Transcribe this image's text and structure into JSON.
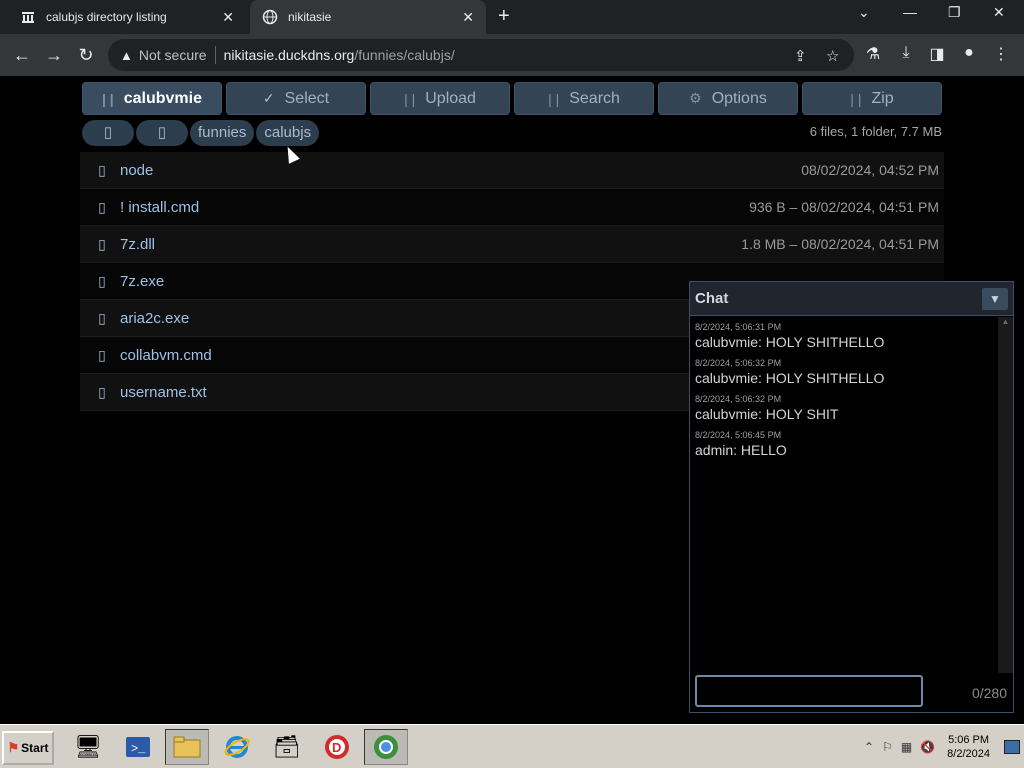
{
  "browser": {
    "tabs": [
      {
        "title": "calubjs directory listing",
        "icon": "bank-icon"
      },
      {
        "title": "nikitasie",
        "icon": "globe-icon"
      }
    ],
    "new_tab": "+",
    "window_controls": {
      "minimize": "—",
      "restore": "❐",
      "close": "✕",
      "dropdown": "⌄"
    },
    "nav": {
      "back": "←",
      "forward": "→",
      "reload": "↻"
    },
    "address": {
      "security_text": "Not secure",
      "host": "nikitasie.duckdns.org",
      "path": "/funnies/calubjs/"
    }
  },
  "page": {
    "toolbar": [
      {
        "label": "calubvmie",
        "icon": "| |"
      },
      {
        "label": "Select",
        "icon": "✓"
      },
      {
        "label": "Upload",
        "icon": "| |"
      },
      {
        "label": "Search",
        "icon": "| |"
      },
      {
        "label": "Options",
        "icon": "⚙"
      },
      {
        "label": "Zip",
        "icon": "| |"
      }
    ],
    "breadcrumbs": [
      {
        "label": "▯"
      },
      {
        "label": "▯"
      },
      {
        "label": "funnies"
      },
      {
        "label": "calubjs"
      }
    ],
    "summary": "6 files, 1 folder, 7.7 MB",
    "files": [
      {
        "icon": "▯",
        "name": "node",
        "meta": "08/02/2024, 04:52 PM"
      },
      {
        "icon": "▯",
        "name": "! install.cmd",
        "meta": "936 B – 08/02/2024, 04:51 PM"
      },
      {
        "icon": "▯",
        "name": "7z.dll",
        "meta": "1.8 MB – 08/02/2024, 04:51 PM"
      },
      {
        "icon": "▯",
        "name": "7z.exe",
        "meta": ""
      },
      {
        "icon": "▯",
        "name": "aria2c.exe",
        "meta": ""
      },
      {
        "icon": "▯",
        "name": "collabvm.cmd",
        "meta": ""
      },
      {
        "icon": "▯",
        "name": "username.txt",
        "meta": ""
      }
    ]
  },
  "chat": {
    "title": "Chat",
    "toggle": "▼",
    "messages": [
      {
        "time": "8/2/2024, 5:06:31 PM",
        "text": "calubvmie: HOLY SHITHELLO"
      },
      {
        "time": "8/2/2024, 5:06:32 PM",
        "text": "calubvmie: HOLY SHITHELLO"
      },
      {
        "time": "8/2/2024, 5:06:32 PM",
        "text": "calubvmie: HOLY SHIT"
      },
      {
        "time": "8/2/2024, 5:06:45 PM",
        "text": "admin: HELLO"
      }
    ],
    "input_value": "",
    "counter": "0/280"
  },
  "taskbar": {
    "start_label": "Start",
    "clock_time": "5:06 PM",
    "clock_date": "8/2/2024"
  }
}
